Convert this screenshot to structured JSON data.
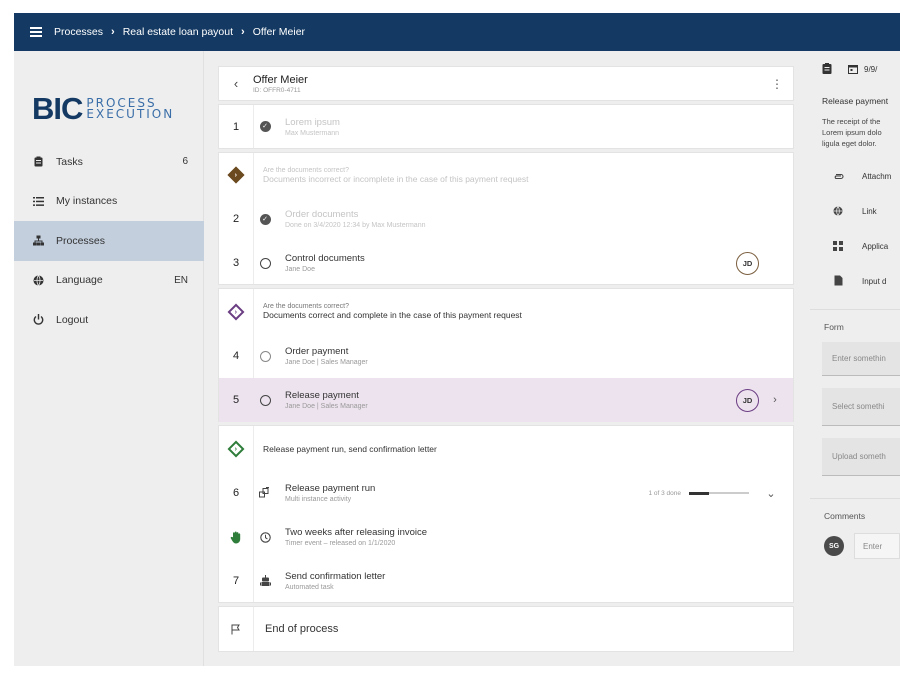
{
  "breadcrumb": [
    "Processes",
    "Real estate loan payout",
    "Offer Meier"
  ],
  "logo": {
    "main": "BIC",
    "sub1": "PROCESS",
    "sub2": "EXECUTION"
  },
  "sidebar": {
    "items": [
      {
        "label": "Tasks",
        "value": "6",
        "icon": "clipboard-icon"
      },
      {
        "label": "My instances",
        "value": "",
        "icon": "list-icon"
      },
      {
        "label": "Processes",
        "value": "",
        "icon": "hierarchy-icon",
        "active": true
      },
      {
        "label": "Language",
        "value": "EN",
        "icon": "globe-icon"
      },
      {
        "label": "Logout",
        "value": "",
        "icon": "power-icon"
      }
    ]
  },
  "header": {
    "title": "Offer Meier",
    "id": "ID: OFFR0-4711"
  },
  "steps": {
    "s1": {
      "num": "1",
      "title": "Lorem ipsum",
      "sub": "Max Mustermann"
    },
    "g1": {
      "question": "Are the documents correct?",
      "answer": "Documents incorrect or incomplete in the case of this payment request"
    },
    "s2": {
      "num": "2",
      "title": "Order documents",
      "sub": "Done on 3/4/2020 12:34 by Max Mustermann"
    },
    "s3": {
      "num": "3",
      "title": "Control documents",
      "sub": "Jane Doe",
      "avatar": "JD"
    },
    "g2": {
      "question": "Are the documents correct?",
      "answer": "Documents correct and complete in the case of this payment request"
    },
    "s4": {
      "num": "4",
      "title": "Order payment",
      "sub": "Jane Doe | Sales Manager"
    },
    "s5": {
      "num": "5",
      "title": "Release payment",
      "sub": "Jane Doe | Sales Manager",
      "avatar": "JD"
    },
    "g3": {
      "answer": "Release payment run, send confirmation letter"
    },
    "s6": {
      "num": "6",
      "title": "Release payment run",
      "sub": "Multi instance activity",
      "progress_text": "1 of 3 done",
      "progress": 0.33
    },
    "timer": {
      "title": "Two weeks after releasing invoice",
      "sub": "Timer event – released on 1/1/2020"
    },
    "s7": {
      "num": "7",
      "title": "Send confirmation letter",
      "sub": "Automated task"
    },
    "end": {
      "title": "End of process"
    }
  },
  "right_panel": {
    "date": "9/9/",
    "title": "Release payment",
    "desc": [
      "The receipt of the",
      "Lorem ipsum dolo",
      "ligula eget dolor."
    ],
    "links": [
      {
        "label": "Attachm",
        "icon": "attachment-icon"
      },
      {
        "label": "Link",
        "icon": "globe-icon"
      },
      {
        "label": "Applica",
        "icon": "apps-icon"
      },
      {
        "label": "Input d",
        "icon": "document-icon"
      }
    ],
    "form_label": "Form",
    "fields": [
      "Enter somethin",
      "Select somethi",
      "Upload someth"
    ],
    "comments_label": "Comments",
    "comment_avatar": "SG",
    "comment_placeholder": "Enter"
  },
  "colors": {
    "topbar": "#143a63",
    "active_nav": "#c3cfdd",
    "highlight_row": "#ede3ee",
    "gateway_purple": "#6b3d83",
    "gateway_green": "#2f7d3a",
    "gateway_dark": "#6b4a1f"
  }
}
